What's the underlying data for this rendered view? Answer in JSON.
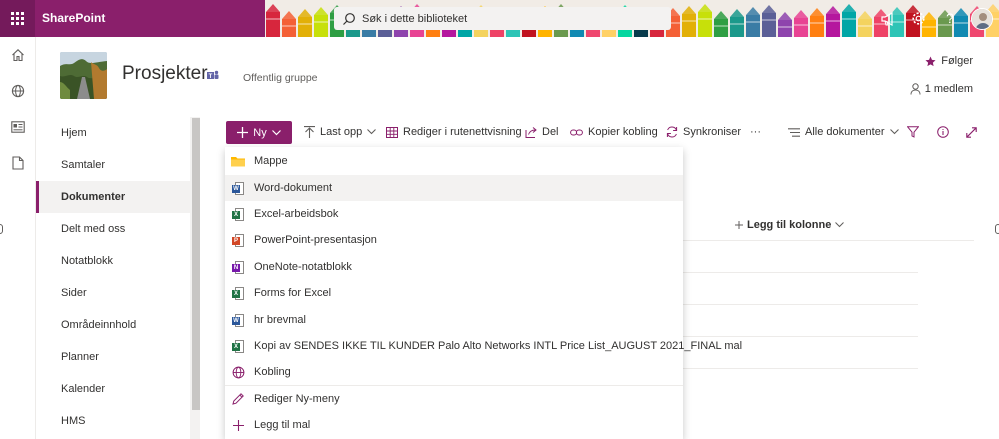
{
  "suitebar": {
    "brand": "SharePoint",
    "search_placeholder": "Søk i dette biblioteket",
    "icons": [
      "waffle-icon",
      "megaphone-icon",
      "settings-icon",
      "help-icon",
      "avatar"
    ],
    "accent": "#8a1f6b"
  },
  "site": {
    "title": "Prosjekter",
    "type": "Offentlig gruppe",
    "follow_label": "Følger",
    "members_label": "1 medlem"
  },
  "leftnav": {
    "items": [
      {
        "label": "Hjem"
      },
      {
        "label": "Samtaler"
      },
      {
        "label": "Dokumenter",
        "active": true
      },
      {
        "label": "Delt med oss"
      },
      {
        "label": "Notatblokk"
      },
      {
        "label": "Sider"
      },
      {
        "label": "Områdeinnhold"
      },
      {
        "label": "Planner"
      },
      {
        "label": "Kalender"
      },
      {
        "label": "HMS"
      }
    ]
  },
  "commandbar": {
    "new_label": "Ny",
    "upload_label": "Last opp",
    "grid_label": "Rediger i rutenettvisning",
    "share_label": "Del",
    "copylink_label": "Kopier kobling",
    "sync_label": "Synkroniser",
    "more_label": "···",
    "view_label": "Alle dokumenter"
  },
  "library": {
    "add_column_label": "Legg til kolonne"
  },
  "newmenu": {
    "items": [
      {
        "label": "Mappe",
        "icon": "folder-icon"
      },
      {
        "label": "Word-dokument",
        "icon": "word-icon"
      },
      {
        "label": "Excel-arbeidsbok",
        "icon": "excel-icon"
      },
      {
        "label": "PowerPoint-presentasjon",
        "icon": "powerpoint-icon"
      },
      {
        "label": "OneNote-notatblokk",
        "icon": "onenote-icon"
      },
      {
        "label": "Forms for Excel",
        "icon": "excel-icon"
      },
      {
        "label": "hr brevmal",
        "icon": "word-icon"
      },
      {
        "label": "Kopi av SENDES IKKE TIL KUNDER Palo Alto Networks INTL Price List_AUGUST 2021_FINAL mal",
        "icon": "excel-icon"
      },
      {
        "label": "Kobling",
        "icon": "globe-icon"
      }
    ],
    "footer": [
      {
        "label": "Rediger Ny-meny",
        "icon": "pencil-icon"
      },
      {
        "label": "Legg til mal",
        "icon": "plus-icon"
      }
    ]
  },
  "colors": {
    "word": "#2b579a",
    "excel": "#217346",
    "powerpoint": "#d24726",
    "onenote": "#7719aa",
    "folder": "#ffb900"
  }
}
